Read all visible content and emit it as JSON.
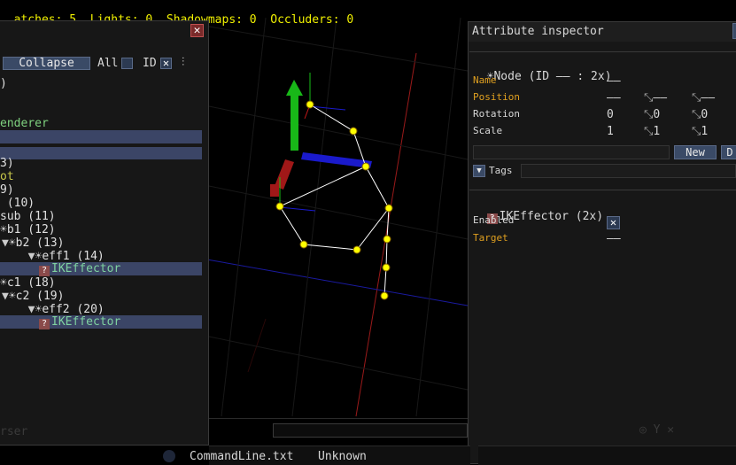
{
  "stats": {
    "batches": "atches: 5",
    "lights": "Lights: 0",
    "shadowmaps": "Shadowmaps: 0",
    "occluders": "Occluders: 0"
  },
  "hierarchy": {
    "close_glyph": "✕",
    "collapse_label": "Collapse",
    "all_label": "All",
    "id_label": "ID",
    "id_checked_glyph": "✕",
    "filter_icon_glyph": "⫶",
    "rows": [
      {
        "text": ")",
        "style": "normal",
        "selected": false
      },
      {
        "text": "",
        "style": "normal",
        "selected": false
      },
      {
        "text": "enderer",
        "style": "green",
        "selected": false
      },
      {
        "text": "",
        "style": "normal",
        "selected": true
      },
      {
        "text": "",
        "style": "normal",
        "selected": true
      },
      {
        "text": "3)",
        "style": "normal",
        "selected": false
      },
      {
        "text": "ot",
        "style": "olive",
        "selected": false
      },
      {
        "text": "9)",
        "style": "normal",
        "selected": false
      },
      {
        "text": " (10)",
        "style": "normal",
        "selected": false
      },
      {
        "text": "sub (11)",
        "style": "normal",
        "selected": false
      },
      {
        "text": "b1 (12)",
        "style": "normal",
        "selected": false
      },
      {
        "text": "b2 (13)",
        "style": "normal",
        "selected": false
      },
      {
        "text": "eff1 (14)",
        "style": "normal",
        "selected": false
      },
      {
        "text": "IKEffector",
        "style": "component",
        "selected": true
      },
      {
        "text": "c1 (18)",
        "style": "normal",
        "selected": false
      },
      {
        "text": "c2 (19)",
        "style": "normal",
        "selected": false
      },
      {
        "text": "eff2 (20)",
        "style": "normal",
        "selected": false
      },
      {
        "text": "IKEffector",
        "style": "component",
        "selected": true
      }
    ],
    "faint_footer": "rser"
  },
  "inspector": {
    "title": "Attribute inspector",
    "node_header": "Node (ID —— : 2x)",
    "attributes": [
      {
        "label": "Name",
        "color": "orange",
        "values": [
          "——"
        ]
      },
      {
        "label": "Position",
        "color": "orange",
        "values": [
          "——",
          "——",
          "——"
        ]
      },
      {
        "label": "Rotation",
        "color": "normal",
        "values": [
          "0",
          "0",
          "0"
        ]
      },
      {
        "label": "Scale",
        "color": "normal",
        "values": [
          "1",
          "1",
          "1"
        ]
      }
    ],
    "new_button": "New",
    "tags_label": "Tags",
    "component_header": "IKEffector (2x)",
    "component_attrs": [
      {
        "label": "Enabled",
        "color": "normal",
        "value": "✕"
      },
      {
        "label": "Target",
        "color": "orange",
        "value": "——"
      }
    ]
  },
  "statusbar": {
    "file": "CommandLine.txt",
    "type": "Unknown"
  },
  "colors": {
    "stats": "#f0f000",
    "selection": "#3b4566",
    "bone": "#ffffff",
    "joint": "#ffff00",
    "axis_x": "#d02020",
    "axis_y": "#20c020",
    "axis_z": "#2020d0"
  }
}
